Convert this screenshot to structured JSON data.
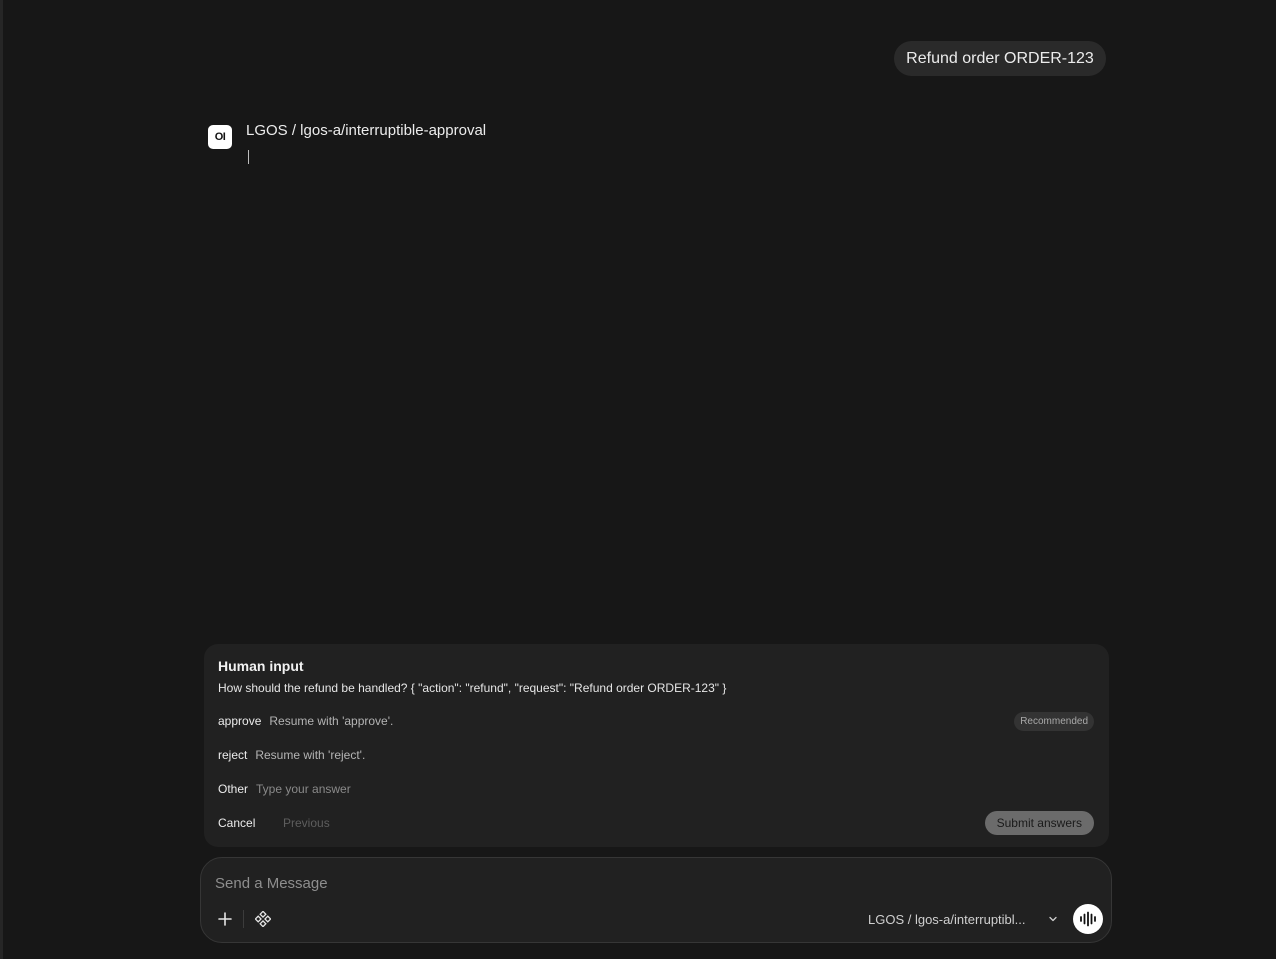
{
  "chat": {
    "user_message": "Refund order ORDER-123",
    "assistant": {
      "avatar_text": "OI",
      "name": "LGOS / lgos-a/interruptible-approval"
    }
  },
  "human_input": {
    "title": "Human input",
    "question": "How should the refund be handled? { \"action\": \"refund\", \"request\": \"Refund order ORDER-123\" }",
    "options": [
      {
        "key": "approve",
        "description": "Resume with 'approve'.",
        "badge": "Recommended"
      },
      {
        "key": "reject",
        "description": "Resume with 'reject'."
      }
    ],
    "other": {
      "key": "Other",
      "placeholder": "Type your answer"
    },
    "footer": {
      "cancel_label": "Cancel",
      "previous_label": "Previous",
      "submit_label": "Submit answers"
    }
  },
  "composer": {
    "placeholder": "Send a Message",
    "model_label": "LGOS / lgos-a/interruptibl...",
    "icons": {
      "plus": "plus-icon",
      "tools": "tools-icon",
      "chevron": "chevron-down-icon",
      "voice": "voice-waveform-icon"
    }
  },
  "colors": {
    "background": "#171717",
    "panel": "#212121",
    "bubble": "#2a2a2a",
    "submit": "#6b6b6b"
  }
}
